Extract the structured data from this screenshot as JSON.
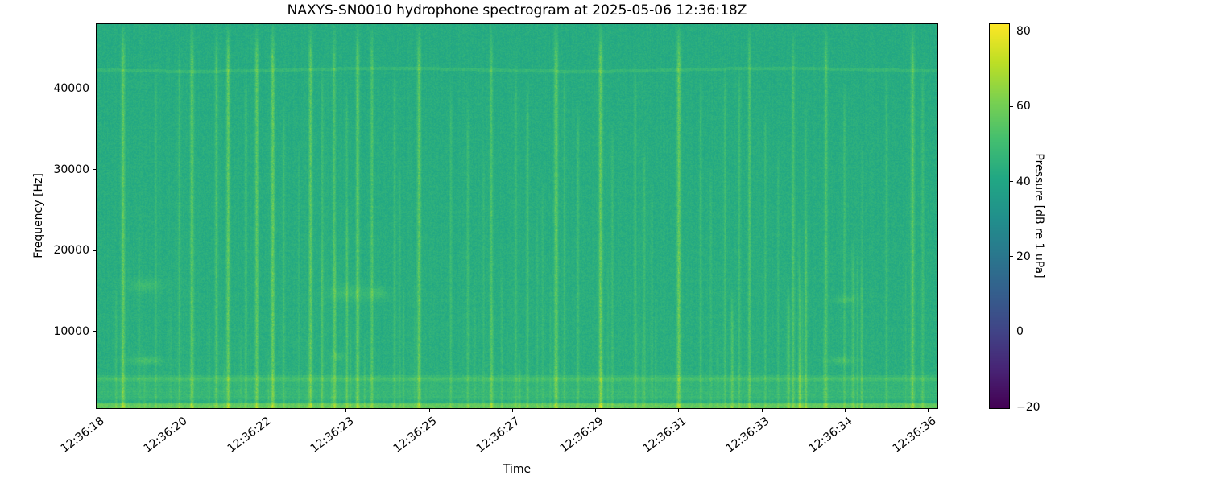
{
  "figure": {
    "title": "NAXYS-SN0010 hydrophone spectrogram at 2025-05-06 12:36:18Z",
    "xlabel": "Time",
    "ylabel": "Frequency [Hz]",
    "colorbar_label": "Pressure [dB re 1 uPa]"
  },
  "chart_data": {
    "type": "heatmap",
    "subtype": "spectrogram",
    "colormap": "viridis",
    "title": "NAXYS-SN0010 hydrophone spectrogram at 2025-05-06 12:36:18Z",
    "xlabel": "Time",
    "ylabel": "Frequency [Hz]",
    "x_tick_labels": [
      "12:36:18",
      "12:36:20",
      "12:36:22",
      "12:36:23",
      "12:36:25",
      "12:36:27",
      "12:36:29",
      "12:36:31",
      "12:36:33",
      "12:36:34",
      "12:36:36"
    ],
    "x_tick_seconds": [
      18,
      19.8,
      21.6,
      23.4,
      25.2,
      27,
      28.8,
      30.6,
      32.4,
      34.2,
      36
    ],
    "x_range_seconds": [
      18,
      36.2
    ],
    "y_tick_values": [
      10000,
      20000,
      30000,
      40000
    ],
    "y_range_hz": [
      500,
      48000
    ],
    "grid": false,
    "colorbar": {
      "label": "Pressure [dB re 1 uPa]",
      "tick_labels": [
        "80",
        "60",
        "40",
        "20",
        "0",
        "−20"
      ],
      "tick_values": [
        80,
        60,
        40,
        20,
        0,
        -20
      ],
      "range_db": [
        -20.3,
        81.9
      ],
      "colormap_rgb": [
        [
          68,
          1,
          84
        ],
        [
          72,
          36,
          117
        ],
        [
          65,
          68,
          135
        ],
        [
          53,
          95,
          141
        ],
        [
          42,
          120,
          142
        ],
        [
          33,
          145,
          140
        ],
        [
          34,
          168,
          132
        ],
        [
          68,
          191,
          112
        ],
        [
          122,
          209,
          81
        ],
        [
          189,
          223,
          38
        ],
        [
          253,
          231,
          37
        ]
      ]
    },
    "background_db": 42.5,
    "features": {
      "narrowband_line_y_frac": 0.118,
      "narrowband_line_boost_db": 3.8,
      "bands": [
        [
          0.912,
          0.975,
          3.5
        ],
        [
          0.917,
          0.929,
          2.5
        ],
        [
          0.975,
          0.987,
          1.0
        ],
        [
          0.987,
          1.0,
          12.5
        ]
      ],
      "transients": [
        [
          0.031,
          18,
          0,
          2.2
        ],
        [
          0.07,
          6,
          0.1,
          1.2
        ],
        [
          0.098,
          9,
          0.05,
          1.5
        ],
        [
          0.113,
          17,
          0,
          2.2
        ],
        [
          0.142,
          13,
          0,
          1.8
        ],
        [
          0.156,
          18,
          0,
          2.2
        ],
        [
          0.177,
          9,
          0.12,
          1.5
        ],
        [
          0.19,
          17,
          0,
          2.0
        ],
        [
          0.209,
          19,
          0,
          2.4
        ],
        [
          0.222,
          8,
          0.2,
          1.4
        ],
        [
          0.24,
          6,
          0.3,
          1.2
        ],
        [
          0.254,
          18,
          0,
          2.2
        ],
        [
          0.268,
          9,
          0.1,
          1.5
        ],
        [
          0.282,
          13,
          0,
          1.8
        ],
        [
          0.297,
          8,
          0.15,
          1.4
        ],
        [
          0.31,
          17,
          0,
          2.1
        ],
        [
          0.327,
          14,
          0,
          1.8
        ],
        [
          0.354,
          9,
          0.1,
          1.5
        ],
        [
          0.36,
          6,
          0.35,
          1.2
        ],
        [
          0.383,
          18,
          0,
          2.2
        ],
        [
          0.421,
          8,
          0.15,
          1.4
        ],
        [
          0.441,
          8,
          0.2,
          1.4
        ],
        [
          0.46,
          6,
          0.3,
          1.2
        ],
        [
          0.469,
          13,
          0,
          1.8
        ],
        [
          0.498,
          8,
          0.1,
          1.4
        ],
        [
          0.512,
          9,
          0.15,
          1.5
        ],
        [
          0.53,
          6,
          0.4,
          1.2
        ],
        [
          0.546,
          18,
          0,
          2.3
        ],
        [
          0.556,
          8,
          0.1,
          1.4
        ],
        [
          0.572,
          9,
          0.2,
          1.5
        ],
        [
          0.599,
          19,
          0,
          2.4
        ],
        [
          0.613,
          8,
          0.25,
          1.4
        ],
        [
          0.64,
          9,
          0.1,
          1.5
        ],
        [
          0.651,
          8,
          0.3,
          1.4
        ],
        [
          0.66,
          6,
          0.4,
          1.2
        ],
        [
          0.692,
          20,
          0,
          2.4
        ],
        [
          0.718,
          8,
          0.15,
          1.4
        ],
        [
          0.73,
          6,
          0.35,
          1.2
        ],
        [
          0.747,
          9,
          0.1,
          1.5
        ],
        [
          0.764,
          9,
          0.1,
          1.5
        ],
        [
          0.776,
          13,
          0,
          1.8
        ],
        [
          0.795,
          8,
          0.2,
          1.4
        ],
        [
          0.81,
          6,
          0.3,
          1.2
        ],
        [
          0.828,
          13,
          0.02,
          1.7
        ],
        [
          0.843,
          8,
          0.2,
          1.4
        ],
        [
          0.867,
          14,
          0,
          1.8
        ],
        [
          0.889,
          9,
          0.15,
          1.5
        ],
        [
          0.91,
          6,
          0.3,
          1.2
        ],
        [
          0.939,
          9,
          0.1,
          1.5
        ],
        [
          0.97,
          16,
          0,
          2.1
        ],
        [
          0.982,
          9,
          0.1,
          1.5
        ]
      ],
      "blobs": [
        [
          0.058,
          0.68,
          20,
          8,
          8
        ],
        [
          0.3,
          0.7,
          26,
          10,
          7
        ],
        [
          0.058,
          0.875,
          22,
          5,
          9
        ],
        [
          0.885,
          0.875,
          16,
          5,
          9
        ],
        [
          0.287,
          0.865,
          9,
          4,
          8
        ],
        [
          0.335,
          0.7,
          12,
          8,
          7
        ],
        [
          0.89,
          0.717,
          14,
          5,
          8
        ]
      ],
      "random_short_transients": 45,
      "noise_db_peak_to_peak": 6.5
    }
  }
}
